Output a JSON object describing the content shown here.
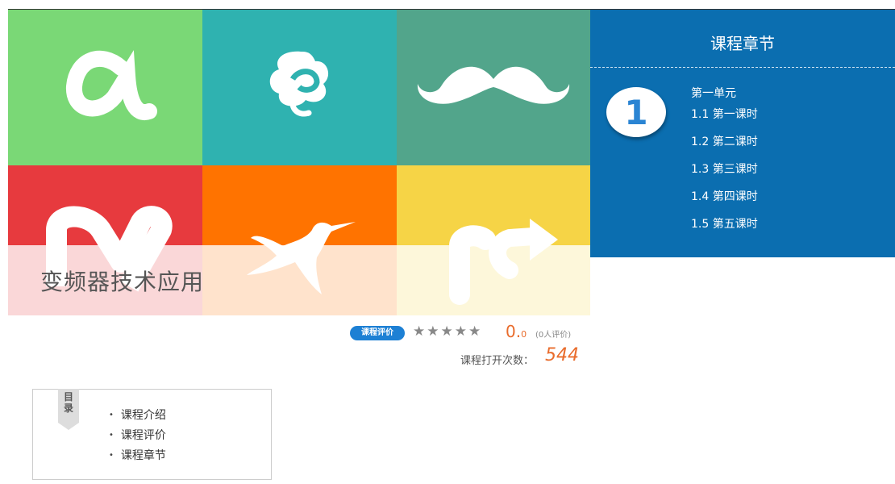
{
  "course": {
    "title": "变频器技术应用"
  },
  "chapters": {
    "panel_title": "课程章节",
    "unit_number": "1",
    "unit_title": "第一单元",
    "lessons": [
      "1.1  第一课时",
      "1.2  第二课时",
      "1.3  第三课时",
      "1.4  第四课时",
      "1.5  第五课时"
    ]
  },
  "rating": {
    "label": "课程评价",
    "stars": "★★★★★",
    "score_int": "0.",
    "score_dec": "0",
    "count_text": "(0人评价)",
    "opens_label": "课程打开次数：",
    "opens_count": "544"
  },
  "toc": {
    "tag": "目录",
    "items": [
      "课程介绍",
      "课程评价",
      "课程章节"
    ]
  },
  "colors": {
    "tile_green": "#7ad876",
    "tile_teal": "#2fb2b0",
    "tile_seagreen": "#52a58b",
    "tile_red": "#e73a3e",
    "tile_orange": "#ff7300",
    "tile_yellow": "#f6d446",
    "panel_blue": "#0b6eb0",
    "accent_orange": "#e96c2c"
  }
}
